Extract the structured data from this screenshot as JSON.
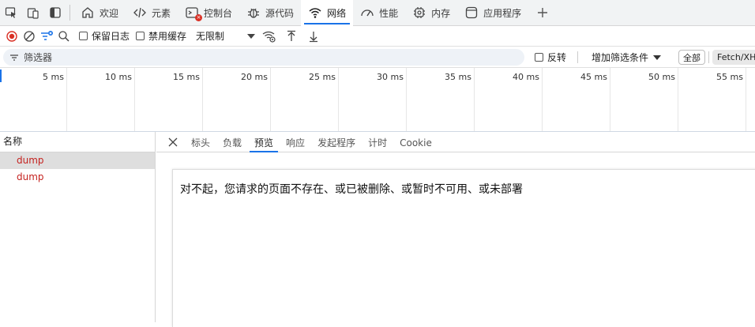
{
  "tabs": [
    {
      "label": "欢迎",
      "icon": "home-icon"
    },
    {
      "label": "元素",
      "icon": "code-icon"
    },
    {
      "label": "控制台",
      "icon": "console-icon"
    },
    {
      "label": "源代码",
      "icon": "bug-icon"
    },
    {
      "label": "网络",
      "icon": "wifi-icon"
    },
    {
      "label": "性能",
      "icon": "gauge-icon"
    },
    {
      "label": "内存",
      "icon": "chip-icon"
    },
    {
      "label": "应用程序",
      "icon": "app-icon"
    }
  ],
  "console_badge": "×",
  "toolbar": {
    "preserve_log": "保留日志",
    "disable_cache": "禁用缓存",
    "throttle": "无限制"
  },
  "filter": {
    "placeholder": "筛选器",
    "invert": "反转",
    "more_filters": "增加筛选条件",
    "all": "全部",
    "fetch": "Fetch/XH"
  },
  "timeline": {
    "ticks": [
      "5 ms",
      "10 ms",
      "15 ms",
      "20 ms",
      "25 ms",
      "30 ms",
      "35 ms",
      "40 ms",
      "45 ms",
      "50 ms",
      "55 ms"
    ]
  },
  "requests": {
    "header": "名称",
    "rows": [
      "dump",
      "dump"
    ]
  },
  "detail": {
    "tabs": [
      "标头",
      "负载",
      "预览",
      "响应",
      "发起程序",
      "计时",
      "Cookie"
    ],
    "active_tab": "预览",
    "message": "对不起，您请求的页面不存在、或已被删除、或暂时不可用、或未部署"
  },
  "colors": {
    "accent": "#1a73e8",
    "error": "#c5221f",
    "record": "#d93025"
  }
}
